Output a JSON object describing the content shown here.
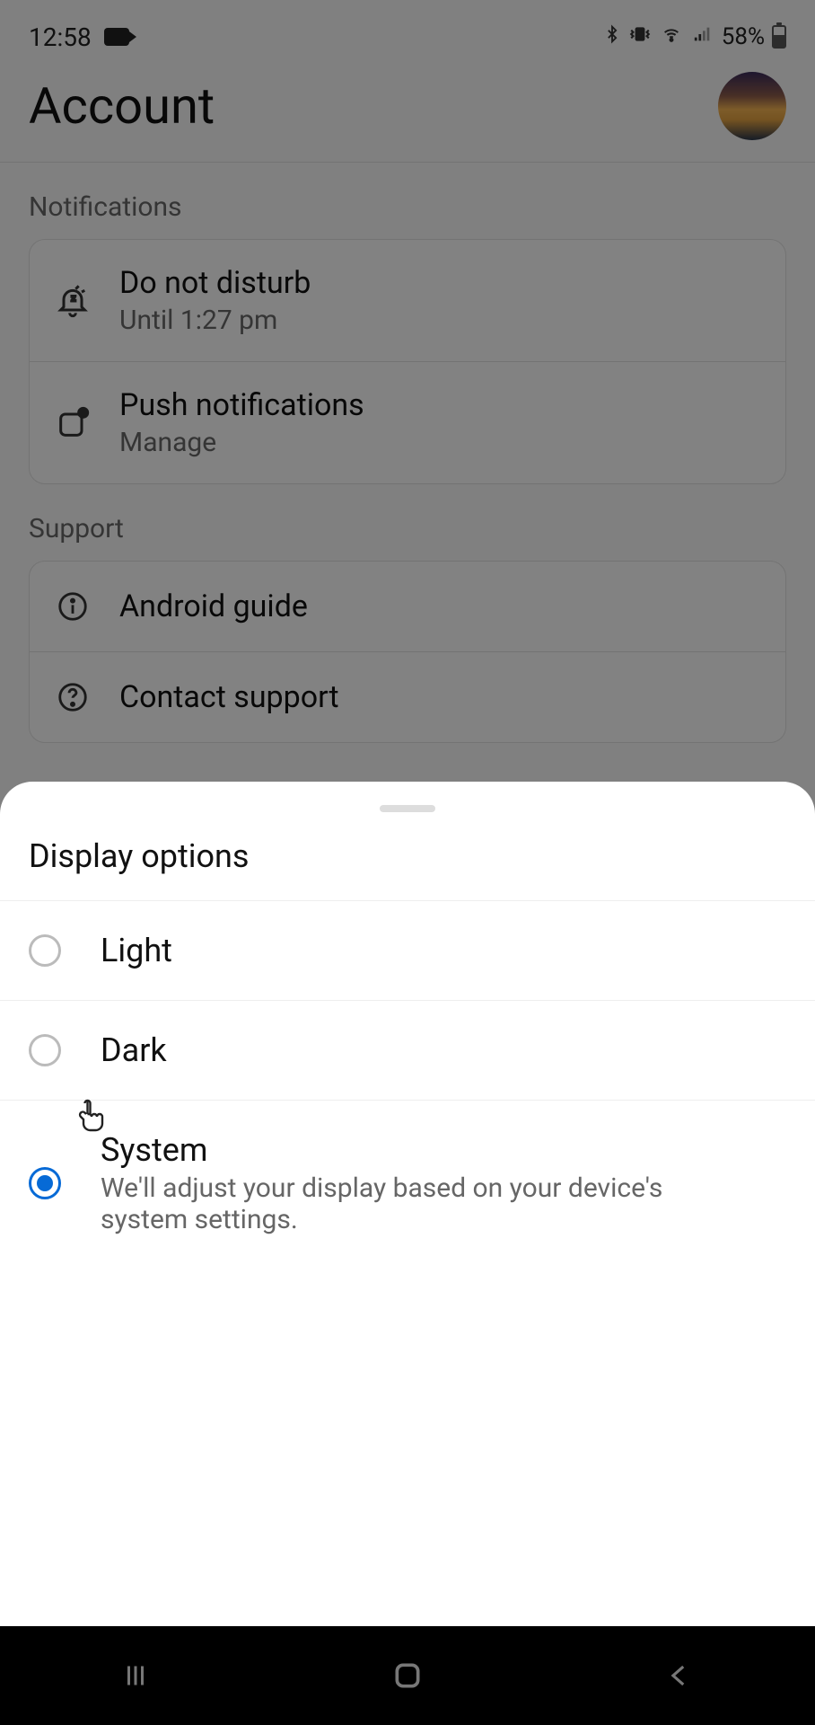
{
  "status": {
    "time": "12:58",
    "battery_pct": "58%"
  },
  "header": {
    "title": "Account"
  },
  "sections": {
    "notifications": {
      "label": "Notifications",
      "dnd": {
        "title": "Do not disturb",
        "sub": "Until 1:27 pm"
      },
      "push": {
        "title": "Push notifications",
        "sub": "Manage"
      }
    },
    "support": {
      "label": "Support",
      "guide": {
        "title": "Android guide"
      },
      "contact": {
        "title": "Contact support"
      }
    }
  },
  "sheet": {
    "title": "Display options",
    "options": {
      "light": {
        "label": "Light",
        "selected": false
      },
      "dark": {
        "label": "Dark",
        "selected": false
      },
      "system": {
        "label": "System",
        "sub": "We'll adjust your display based on your device's system settings.",
        "selected": true
      }
    }
  }
}
